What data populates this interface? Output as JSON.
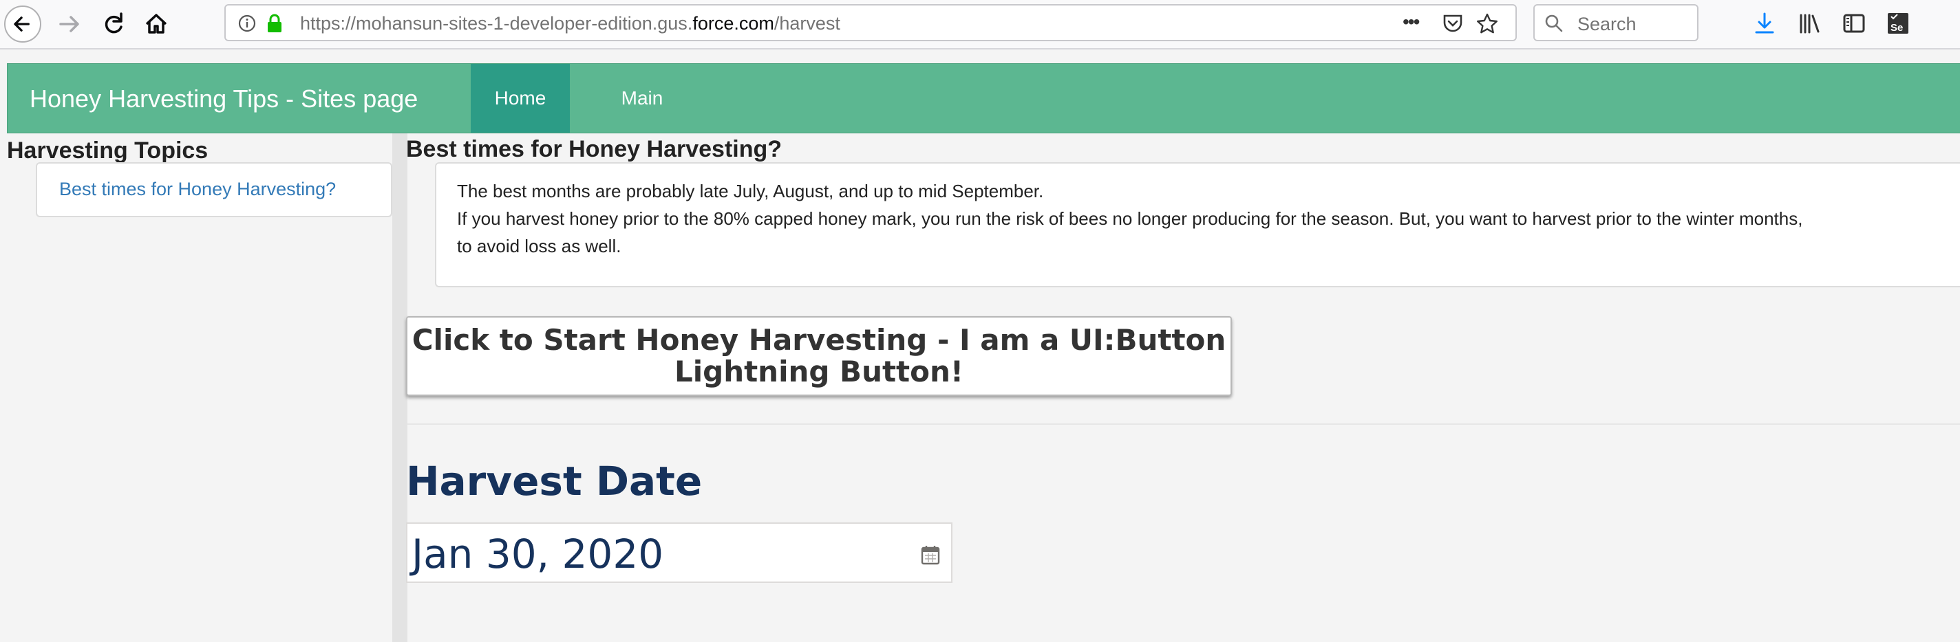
{
  "browser": {
    "url_prefix": "https://mohansun-sites-1-developer-edition.gus.",
    "url_domain": "force.com",
    "url_path": "/harvest",
    "search_placeholder": "Search",
    "actions_icon": "•••"
  },
  "header": {
    "brand": "Honey Harvesting Tips - Sites page",
    "nav": [
      {
        "label": "Home",
        "active": true
      },
      {
        "label": "Main",
        "active": false
      }
    ]
  },
  "sidebar": {
    "title": "Harvesting Topics",
    "topics": [
      "Best times for Honey Harvesting?"
    ]
  },
  "main": {
    "title": "Best times for Honey Harvesting?",
    "paragraphs": [
      "The best months are probably late July, August, and up to mid September.",
      "If you harvest honey prior to the 80% capped honey mark, you run the risk of bees no longer producing for the season. But, you want to harvest prior to the winter months,",
      "to avoid loss as well."
    ],
    "button_line1": "Click to Start Honey Harvesting - I am a UI:Button",
    "button_line2": "Lightning Button!",
    "date_label": "Harvest Date",
    "date_value": "Jan 30, 2020"
  },
  "colors": {
    "header_bg": "#5cb791",
    "nav_active_bg": "#2c9c86",
    "link": "#337ab7",
    "date_text": "#16325c"
  }
}
